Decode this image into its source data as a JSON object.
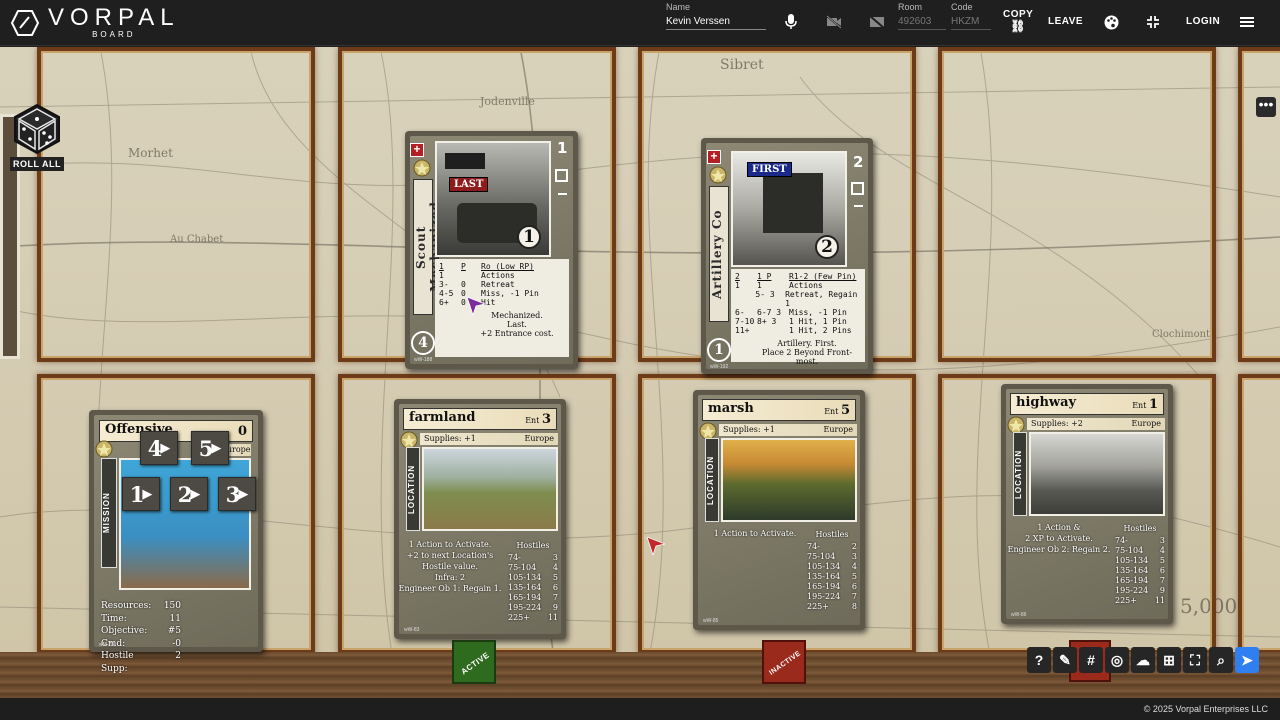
{
  "app": {
    "logo_text": "VORPAL",
    "logo_sub": "BOARD"
  },
  "header": {
    "name_label": "Name",
    "name_value": "Kevin Verssen",
    "room_label": "Room",
    "room_value": "492603",
    "code_label": "Code",
    "code_value": "HKZM",
    "copy_label": "COPY",
    "leave_label": "LEAVE",
    "login_label": "LOGIN",
    "icons": [
      "microphone-icon",
      "video-off-icon",
      "screen-off-icon",
      "link-icon",
      "palette-icon",
      "compress-icon",
      "menu-icon"
    ]
  },
  "board": {
    "roll_all_label": "ROLL ALL",
    "more_label": "•••"
  },
  "cards": {
    "scout": {
      "side_label": "Scout Mechanized",
      "tag": "LAST",
      "circle_number": "1",
      "corner_number": "1",
      "bottom_number": "4",
      "table_header": [
        "1",
        "P",
        "Ro (Low RP)"
      ],
      "rows": [
        [
          "1",
          "",
          "Actions"
        ],
        [
          "3-",
          "0",
          "Retreat"
        ],
        [
          "4-5",
          "0",
          "Miss, -1 Pin"
        ],
        [
          "6+",
          "0",
          "Hit"
        ]
      ],
      "notes": [
        "Mechanized.",
        "Last.",
        "+2 Entrance cost."
      ],
      "code": "wW-188"
    },
    "artillery": {
      "side_label": "Artillery Co",
      "tag": "FIRST",
      "circle_number": "2",
      "corner_number": "2",
      "bottom_number": "1",
      "table_header": [
        "2",
        "1 P",
        "R1-2 (Few Pin)"
      ],
      "rows": [
        [
          "1",
          "1",
          "Actions"
        ],
        [
          "",
          "5-  3",
          "Retreat, Regain 1"
        ],
        [
          "6-",
          "6-7  3",
          "Miss, -1 Pin"
        ],
        [
          "7-10",
          "8+  3",
          "1 Hit, 1 Pin"
        ],
        [
          "11+",
          "",
          "1 Hit, 2 Pins"
        ]
      ],
      "notes": [
        "Artillery. First.",
        "Place 2 Beyond Front-most."
      ],
      "code": "wW-192"
    },
    "mission": {
      "title": "Offensive",
      "ent_value": "0",
      "region": "Europe",
      "side_label": "MISSION",
      "order_chips": [
        "4",
        "5",
        "1",
        "2",
        "3"
      ],
      "stats": [
        {
          "k": "Resources:",
          "v": "150"
        },
        {
          "k": "Time:",
          "v": "11"
        },
        {
          "k": "Objective:",
          "v": "#5"
        },
        {
          "k": "Cmd:",
          "v": "-0"
        },
        {
          "k": "Hostile Supp:",
          "v": "2"
        }
      ],
      "code": "wM-73"
    },
    "farmland": {
      "title": "farmland",
      "ent_label": "Ent",
      "ent_value": "3",
      "supplies": "Supplies: +1",
      "region": "Europe",
      "side_label": "LOCATION",
      "text": [
        "1 Action to Activate.",
        "+2 to next Location's",
        "Hostile value.",
        "Infra: 2",
        "Engineer Ob 1: Regain 1."
      ],
      "hostiles_title": "Hostiles",
      "hostiles": [
        [
          "74-",
          "3"
        ],
        [
          "75-104",
          "4"
        ],
        [
          "105-134",
          "5"
        ],
        [
          "135-164",
          "6"
        ],
        [
          "165-194",
          "7"
        ],
        [
          "195-224",
          "9"
        ],
        [
          "225+",
          "11"
        ]
      ],
      "code": "wW-83"
    },
    "marsh": {
      "title": "marsh",
      "ent_label": "Ent",
      "ent_value": "5",
      "supplies": "Supplies: +1",
      "region": "Europe",
      "side_label": "LOCATION",
      "text": [
        "1 Action to Activate."
      ],
      "hostiles_title": "Hostiles",
      "hostiles": [
        [
          "74-",
          "2"
        ],
        [
          "75-104",
          "3"
        ],
        [
          "105-134",
          "4"
        ],
        [
          "135-164",
          "5"
        ],
        [
          "165-194",
          "6"
        ],
        [
          "195-224",
          "7"
        ],
        [
          "225+",
          "8"
        ]
      ],
      "code": "wW-85"
    },
    "highway": {
      "title": "highway",
      "ent_label": "Ent",
      "ent_value": "1",
      "supplies": "Supplies: +2",
      "region": "Europe",
      "side_label": "LOCATION",
      "text": [
        "1 Action &",
        "2 XP to Activate.",
        "Engineer Ob 2: Regain 2."
      ],
      "hostiles_title": "Hostiles",
      "hostiles": [
        [
          "74-",
          "3"
        ],
        [
          "75-104",
          "4"
        ],
        [
          "105-134",
          "5"
        ],
        [
          "135-164",
          "6"
        ],
        [
          "165-194",
          "7"
        ],
        [
          "195-224",
          "9"
        ],
        [
          "225+",
          "11"
        ]
      ],
      "code": "wW-86"
    }
  },
  "tokens": {
    "active_label": "ACTIVE",
    "inactive_label": "INACTIVE",
    "active_color": "#2f6b1e",
    "inactive_color": "#9a2a1c"
  },
  "map_labels": [
    "Sibret",
    "Jodenville",
    "Morhet",
    "Au Chabet",
    "Clochimont",
    "5,000"
  ],
  "toolbar": {
    "tools": [
      {
        "name": "help-icon",
        "glyph": "?"
      },
      {
        "name": "eraser-icon",
        "glyph": "✎"
      },
      {
        "name": "grid-hash-icon",
        "glyph": "#"
      },
      {
        "name": "focus-icon",
        "glyph": "◎"
      },
      {
        "name": "cloud-upload-icon",
        "glyph": "☁"
      },
      {
        "name": "grid-icon",
        "glyph": "⊞"
      },
      {
        "name": "fit-screen-icon",
        "glyph": "⛶"
      },
      {
        "name": "zoom-icon",
        "glyph": "⌕"
      },
      {
        "name": "pointer-icon",
        "glyph": "➤"
      }
    ]
  },
  "footer": {
    "copyright": "© 2025 Vorpal Enterprises LLC"
  }
}
